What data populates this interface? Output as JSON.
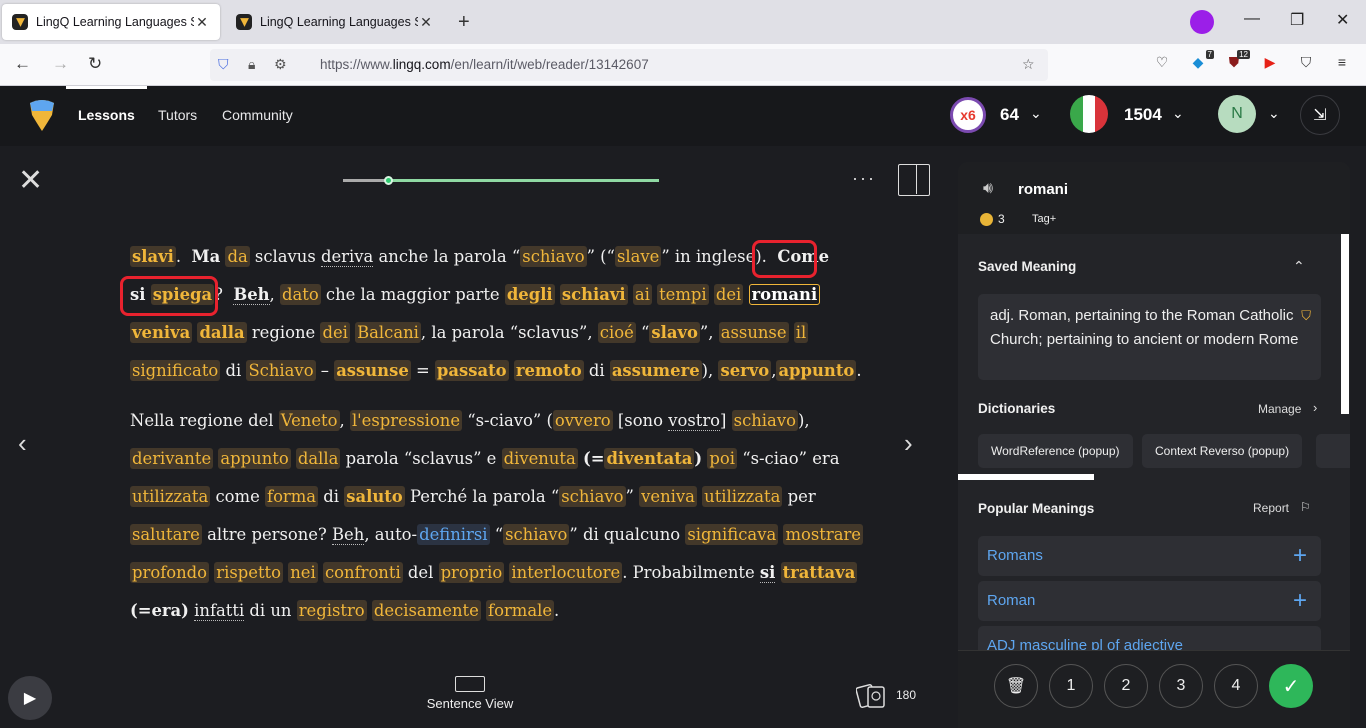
{
  "browser": {
    "tabs": [
      {
        "title": "LingQ Learning Languages Simp",
        "close": "✕"
      },
      {
        "title": "LingQ Learning Languages Simp",
        "close": "✕"
      }
    ],
    "new_tab": "+",
    "url_prefix": "https://www.",
    "url_domain": "lingq.com",
    "url_path": "/en/learn/it/web/reader/13142607",
    "ext_badge_1": "7",
    "ext_badge_2": "12"
  },
  "header": {
    "nav": [
      "Lessons",
      "Tutors",
      "Community"
    ],
    "streak": "x6",
    "coins": "64",
    "known_words": "1504",
    "avatar_initial": "N",
    "colors": {
      "accent": "#f0b63a",
      "green": "#2eb75a",
      "blue": "#5ea6f0"
    }
  },
  "reader": {
    "sentence_view": "Sentence View",
    "cards_count": "180",
    "progress_fraction": 0.14
  },
  "side": {
    "term": "romani",
    "coin_count": "3",
    "tag": "Tag+",
    "saved_meaning_title": "Saved Meaning",
    "saved_meaning": "adj. Roman, pertaining to the Roman Catholic Church; pertaining to ancient or modern Rome",
    "dictionaries_title": "Dictionaries",
    "manage": "Manage",
    "dictionaries": [
      "WordReference (popup)",
      "Context Reverso (popup)"
    ],
    "popular_title": "Popular Meanings",
    "report": "Report",
    "popular": [
      "Romans",
      "Roman",
      "ADJ masculine pl of adjective"
    ],
    "levels": [
      "1",
      "2",
      "3",
      "4"
    ]
  }
}
